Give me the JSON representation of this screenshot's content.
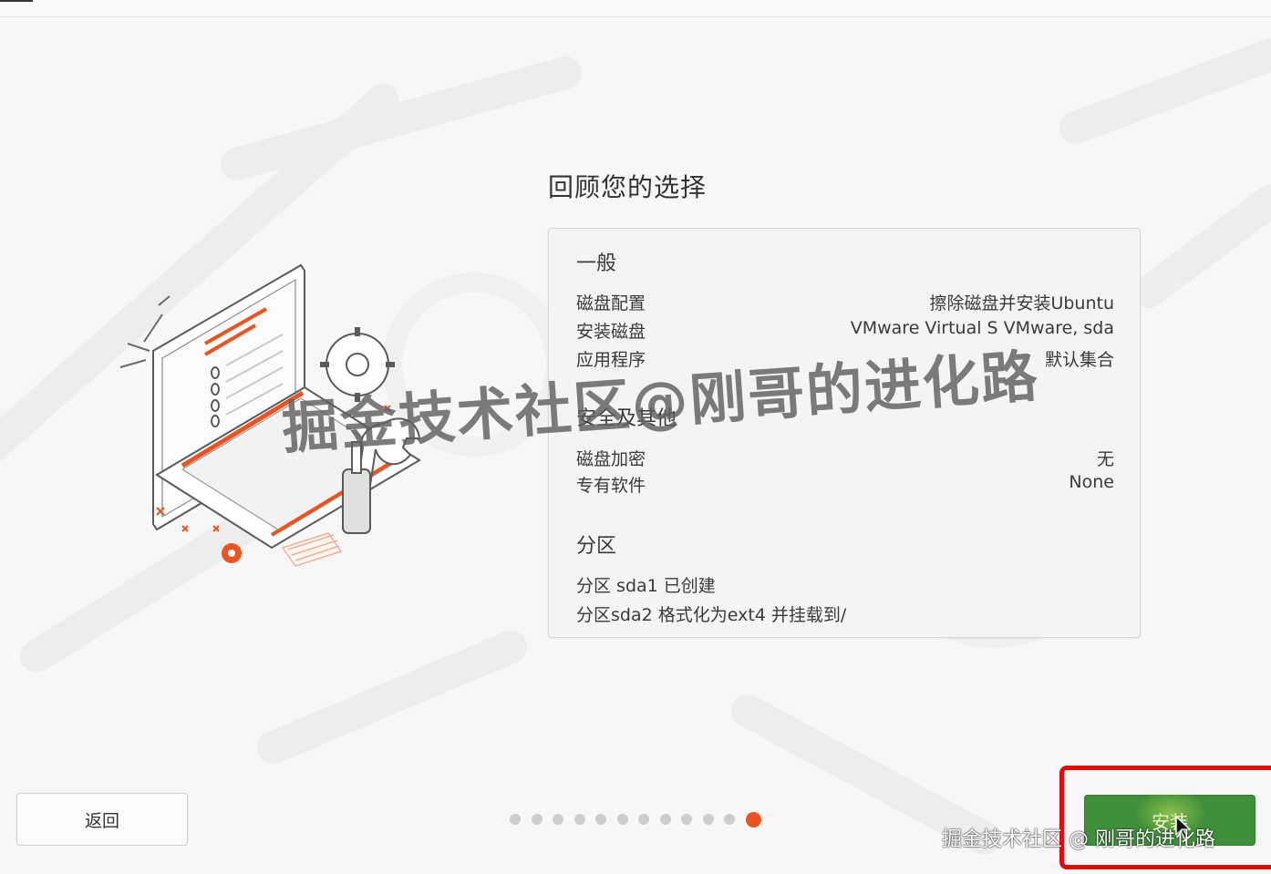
{
  "page_title": "回顾您的选择",
  "sections": {
    "general": {
      "heading": "一般",
      "rows": [
        {
          "key": "磁盘配置",
          "value": "擦除磁盘并安装Ubuntu"
        },
        {
          "key": "安装磁盘",
          "value": "VMware Virtual S VMware, sda"
        },
        {
          "key": "应用程序",
          "value": "默认集合"
        }
      ]
    },
    "security": {
      "heading": "安全及其他",
      "rows": [
        {
          "key": "磁盘加密",
          "value": "无"
        },
        {
          "key": "专有软件",
          "value": "None"
        }
      ]
    },
    "partitions": {
      "heading": "分区",
      "lines": [
        "分区 sda1 已创建",
        "分区sda2 格式化为ext4 并挂载到/"
      ]
    }
  },
  "buttons": {
    "back_label": "返回",
    "install_label": "安装"
  },
  "progress": {
    "total_steps": 12,
    "current_step": 12
  },
  "watermark": {
    "large": "掘金技术社区@刚哥的进化路",
    "small": "掘金技术社区 @ 刚哥的进化路"
  },
  "colors": {
    "accent": "#e95420",
    "install_button": "#3f8f3a",
    "highlight_box": "#e10b0b",
    "dot_inactive": "#cdcdcd"
  },
  "icons": {
    "illustration": "laptop-checklist-tools-illustration",
    "cursor": "mouse-pointer-icon"
  }
}
